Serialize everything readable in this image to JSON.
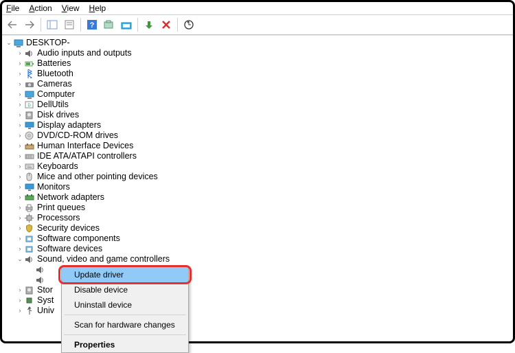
{
  "menu": {
    "file": "File",
    "action": "Action",
    "view": "View",
    "help": "Help"
  },
  "root": "DESKTOP-",
  "categories": [
    "Audio inputs and outputs",
    "Batteries",
    "Bluetooth",
    "Cameras",
    "Computer",
    "DellUtils",
    "Disk drives",
    "Display adapters",
    "DVD/CD-ROM drives",
    "Human Interface Devices",
    "IDE ATA/ATAPI controllers",
    "Keyboards",
    "Mice and other pointing devices",
    "Monitors",
    "Network adapters",
    "Print queues",
    "Processors",
    "Security devices",
    "Software components",
    "Software devices",
    "Sound, video and game controllers"
  ],
  "after": [
    {
      "label": "Stor",
      "full": "Storage controllers"
    },
    {
      "label": "Syst",
      "full": "System devices"
    },
    {
      "label": "Univ",
      "full": "Universal Serial Bus controllers"
    }
  ],
  "context": {
    "update": "Update driver",
    "disable": "Disable device",
    "uninstall": "Uninstall device",
    "scan": "Scan for hardware changes",
    "properties": "Properties"
  },
  "icons": {
    "audio": "speaker-icon",
    "batteries": "battery-icon",
    "bluetooth": "bluetooth-icon",
    "cameras": "camera-icon",
    "computer": "computer-icon",
    "dellutils": "dell-icon",
    "disk": "disk-icon",
    "display": "display-icon",
    "dvd": "dvd-icon",
    "hid": "hid-icon",
    "ide": "ide-icon",
    "keyboards": "keyboard-icon",
    "mice": "mouse-icon",
    "monitors": "monitor-icon",
    "network": "network-icon",
    "print": "printer-icon",
    "processors": "cpu-icon",
    "security": "security-icon",
    "softcomp": "software-icon",
    "softdev": "software-icon",
    "sound": "speaker-icon",
    "storage": "disk-icon",
    "system": "chip-icon",
    "usb": "usb-icon"
  }
}
